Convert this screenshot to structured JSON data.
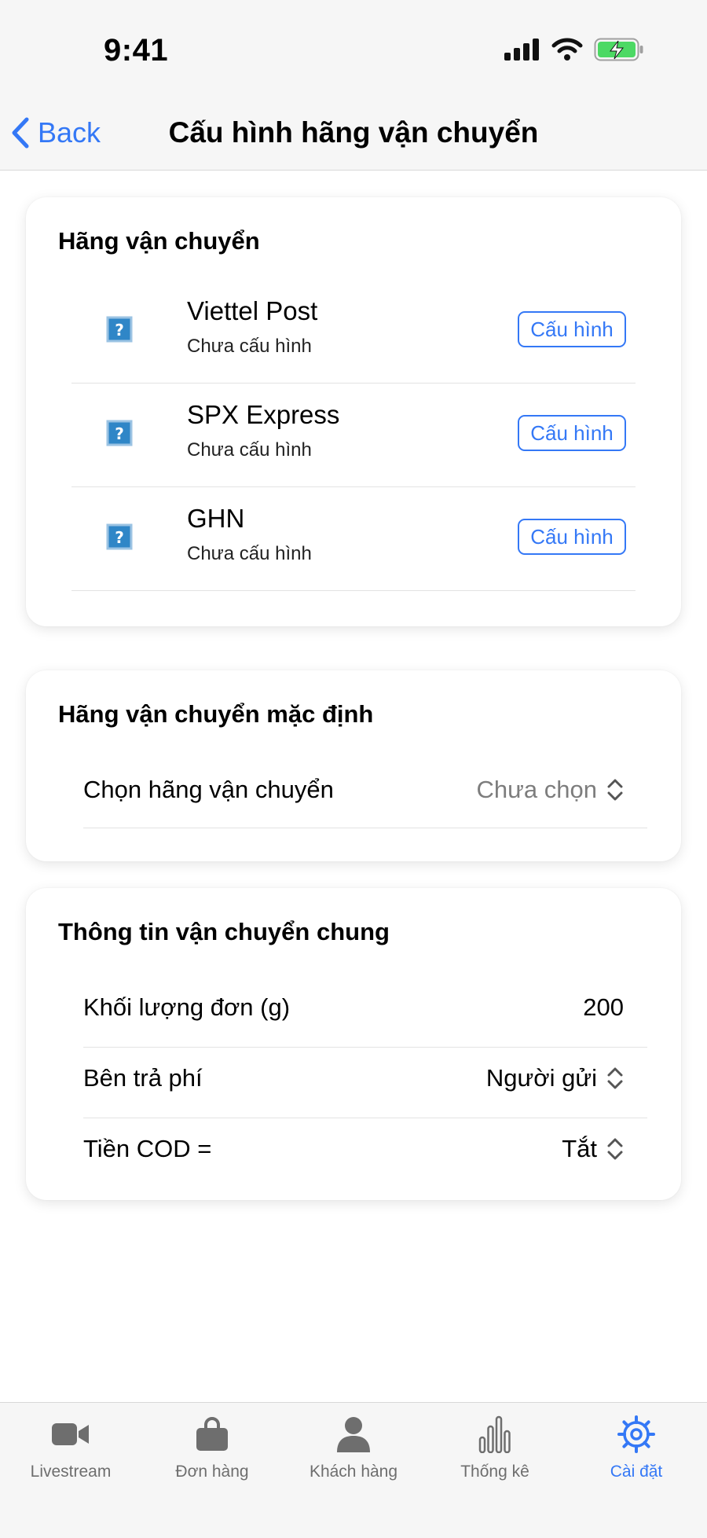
{
  "status_bar": {
    "time": "9:41"
  },
  "nav": {
    "back_label": "Back",
    "title": "Cấu hình hãng vận chuyển"
  },
  "carriers_section": {
    "title": "Hãng vận chuyển",
    "items": [
      {
        "name": "Viettel Post",
        "status": "Chưa cấu hình",
        "button": "Cấu hình"
      },
      {
        "name": "SPX Express",
        "status": "Chưa cấu hình",
        "button": "Cấu hình"
      },
      {
        "name": "GHN",
        "status": "Chưa cấu hình",
        "button": "Cấu hình"
      }
    ]
  },
  "default_section": {
    "title": "Hãng vận chuyển mặc định",
    "select_label": "Chọn hãng vận chuyển",
    "select_value": "Chưa chọn"
  },
  "general_section": {
    "title": "Thông tin vận chuyển chung",
    "weight_label": "Khối lượng đơn (g)",
    "weight_value": "200",
    "payer_label": "Bên trả phí",
    "payer_value": "Người gửi",
    "cod_label": "Tiền COD =",
    "cod_value": "Tắt"
  },
  "tabbar": {
    "tabs": [
      {
        "label": "Livestream",
        "icon": "video-camera-icon"
      },
      {
        "label": "Đơn hàng",
        "icon": "shopping-bag-icon"
      },
      {
        "label": "Khách hàng",
        "icon": "person-icon"
      },
      {
        "label": "Thống kê",
        "icon": "bar-chart-icon"
      },
      {
        "label": "Cài đặt",
        "icon": "gear-icon"
      }
    ],
    "active_index": 4
  },
  "colors": {
    "accent": "#3478f6",
    "battery": "#4cd964"
  }
}
